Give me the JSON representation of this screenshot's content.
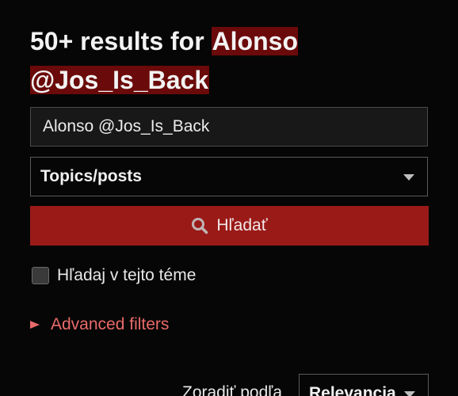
{
  "header": {
    "title_prefix": "50+ results for ",
    "query_highlight": "Alonso @Jos_Is_Back"
  },
  "search": {
    "value": "Alonso @Jos_Is_Back",
    "placeholder": ""
  },
  "scope_select": {
    "selected": "Topics/posts"
  },
  "search_button": {
    "label": "Hľadať",
    "icon": "search-icon"
  },
  "topic_checkbox": {
    "label": "Hľadaj v tejto téme",
    "checked": false
  },
  "advanced_filters": {
    "label": "Advanced filters",
    "expanded": false,
    "icon": "caret-right-icon"
  },
  "sort": {
    "label": "Zoradiť podľa",
    "selected": "Relevancia"
  },
  "colors": {
    "background": "#060606",
    "accent_button": "#9a1a18",
    "highlight": "#6b0a0a",
    "link": "#e96a6a"
  }
}
